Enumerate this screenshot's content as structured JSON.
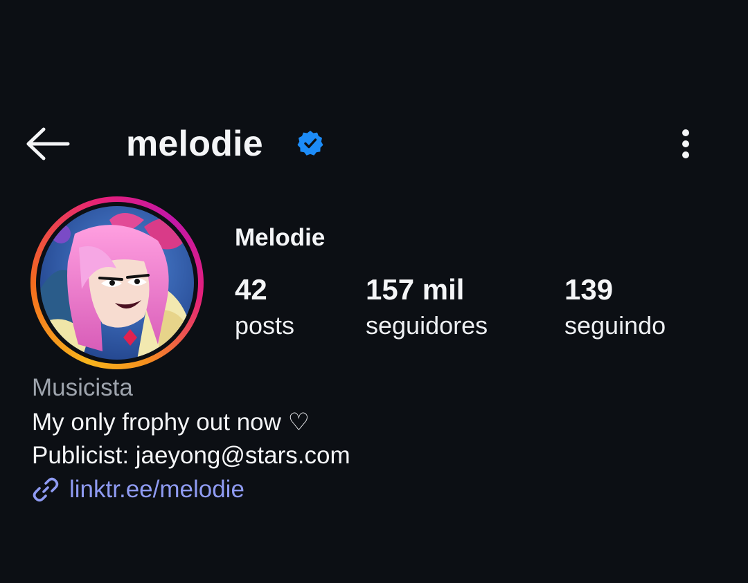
{
  "header": {
    "back_icon": "arrow-left-icon",
    "username": "melodie",
    "verified_icon": "verified-badge-icon",
    "more_icon": "more-vertical-icon"
  },
  "profile": {
    "avatar": "profile-avatar",
    "display_name": "Melodie",
    "stats": {
      "posts": {
        "value": "42",
        "label": "posts"
      },
      "followers": {
        "value": "157 mil",
        "label": "seguidores"
      },
      "following": {
        "value": "139",
        "label": "seguindo"
      }
    },
    "category": "Musicista",
    "bio": [
      "My only frophy out now ♡",
      "Publicist: jaeyong@stars.com"
    ],
    "link": {
      "icon": "link-icon",
      "text": "linktr.ee/melodie"
    }
  },
  "colors": {
    "background": "#0c0f14",
    "text": "#f4f5f7",
    "muted": "#9ea4ad",
    "link": "#8f9bf2",
    "verified": "#1d8cf8",
    "story_ring": [
      "#f8b51d",
      "#f46b1e",
      "#e6207a",
      "#c317a8"
    ]
  }
}
